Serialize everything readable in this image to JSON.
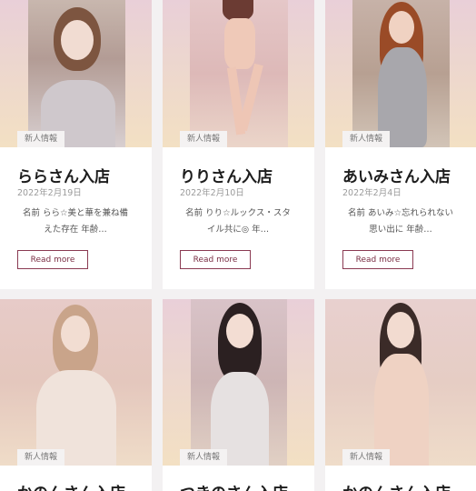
{
  "posts": [
    {
      "category": "新人情報",
      "title": "ららさん入店",
      "date": "2022年2月19日",
      "excerpt": "名前 らら☆美と華を兼ね備えた存在 年齢…",
      "read_more": "Read more"
    },
    {
      "category": "新人情報",
      "title": "りりさん入店",
      "date": "2022年2月10日",
      "excerpt": "名前 りり☆ルックス・スタイル共に◎ 年…",
      "read_more": "Read more"
    },
    {
      "category": "新人情報",
      "title": "あいみさん入店",
      "date": "2022年2月4日",
      "excerpt": "名前 あいみ☆忘れられない思い出に 年齢…",
      "read_more": "Read more"
    },
    {
      "category": "新人情報",
      "title": "かのんさん入店"
    },
    {
      "category": "新人情報",
      "title": "つきのさん入店"
    },
    {
      "category": "新人情報",
      "title": "かのんさん入店"
    }
  ]
}
